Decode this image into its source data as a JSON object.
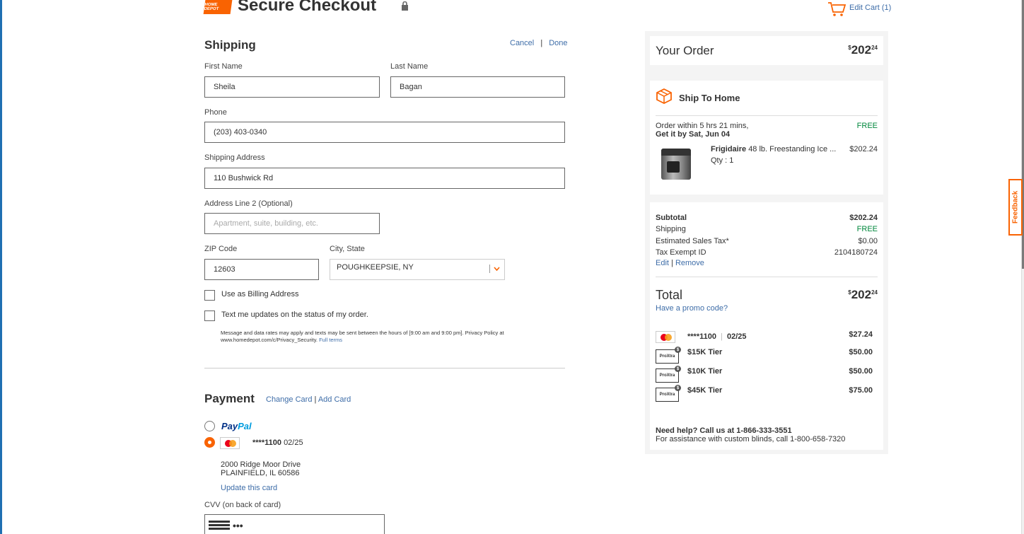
{
  "header": {
    "logo_text": "HOME DEPOT",
    "title": "Secure Checkout",
    "edit_cart": "Edit Cart",
    "cart_count": "(1)"
  },
  "shipping": {
    "title": "Shipping",
    "cancel": "Cancel",
    "separator": "|",
    "done": "Done",
    "first_name_label": "First Name",
    "first_name": "Sheila",
    "last_name_label": "Last Name",
    "last_name": "Bagan",
    "phone_label": "Phone",
    "phone": "(203) 403-0340",
    "address_label": "Shipping Address",
    "address": "110 Bushwick Rd",
    "address2_label": "Address Line 2 (Optional)",
    "address2_placeholder": "Apartment, suite, building, etc.",
    "zip_label": "ZIP Code",
    "zip": "12603",
    "city_label": "City, State",
    "city": "POUGHKEEPSIE, NY",
    "billing_checkbox": "Use as Billing Address",
    "text_checkbox": "Text me updates on the status of my order.",
    "disclaimer_line1": "Message and data rates may apply and texts may be sent between the hours of [9:00 am and 9:00 pm]. Privacy Policy at",
    "disclaimer_line2": "www.homedepot.com/c/Privacy_Security.",
    "full_terms": "Full terms"
  },
  "payment": {
    "title": "Payment",
    "change_card": "Change Card",
    "sep": "|",
    "add_card": "Add Card",
    "paypal_pay": "Pay",
    "paypal_pal": "Pal",
    "card_masked": "****1100",
    "card_exp": "02/25",
    "address_line1": "2000 Ridge Moor Drive",
    "address_line2": "PLAINFIELD, IL 60586",
    "update_card": "Update this card",
    "cvv_label": "CVV (on back of card)",
    "cvv_value": "•••"
  },
  "order": {
    "title": "Your Order",
    "total_dollar_sign": "$",
    "total_whole": "202",
    "total_cents": "24",
    "ship_to_home": "Ship To Home",
    "order_within": "Order within 5 hrs 21 mins,",
    "get_it_by": "Get it by Sat, Jun 04",
    "free": "FREE",
    "product_brand": "Frigidaire",
    "product_name": "48 lb. Freestanding Ice ...",
    "product_price": "$202.24",
    "qty": "Qty : 1",
    "subtotal_label": "Subtotal",
    "subtotal": "$202.24",
    "shipping_label": "Shipping",
    "shipping_value": "FREE",
    "tax_label": "Estimated Sales Tax*",
    "tax_value": "$0.00",
    "tax_exempt_label": "Tax Exempt ID",
    "tax_exempt_value": "2104180724",
    "edit": "Edit",
    "sep": "|",
    "remove": "Remove",
    "total_label": "Total",
    "promo": "Have a promo code?",
    "payments": [
      {
        "label": "****1100",
        "extra": "02/25",
        "amount": "$27.24"
      },
      {
        "label": "$15K Tier",
        "amount": "$50.00"
      },
      {
        "label": "$10K Tier",
        "amount": "$50.00"
      },
      {
        "label": "$45K Tier",
        "amount": "$75.00"
      }
    ],
    "proxtra_label": "ProXtra",
    "help_line1": "Need help? Call us at 1-866-333-3551",
    "help_line2": "For assistance with custom blinds, call 1-800-658-7320"
  },
  "feedback": "Feedback",
  "colors": {
    "brand_orange": "#f96302",
    "link_blue": "#3e6da8",
    "free_green": "#00873c"
  }
}
